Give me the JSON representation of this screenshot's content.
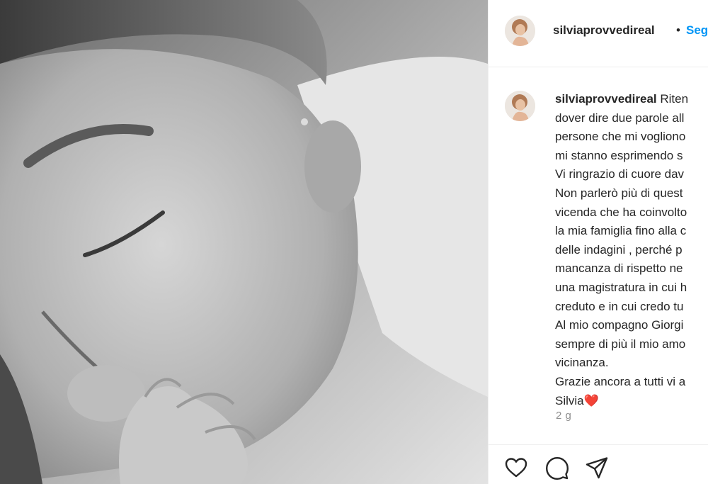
{
  "post": {
    "username": "silviaprovvedireal",
    "follow_label": "Segui",
    "separator": "•",
    "caption_lines": [
      " Riten",
      "dover dire due parole all",
      "persone che mi vogliono",
      "mi stanno esprimendo s",
      "Vi ringrazio di cuore dav",
      "Non parlerò più di quest",
      "vicenda che ha coinvolto",
      "la mia famiglia fino alla c",
      "delle indagini , perché p",
      "mancanza di rispetto ne",
      "una magistratura in cui h",
      "creduto e in cui credo tu",
      "Al mio compagno Giorgi",
      "sempre di più il mio amo",
      "vicinanza.",
      "Grazie ancora a tutti vi a",
      "Silvia"
    ],
    "caption_emoji": "❤️",
    "time_ago": "2 g"
  },
  "actions": {
    "like": "heart-icon",
    "comment": "comment-icon",
    "share": "share-icon"
  },
  "colors": {
    "text": "#262626",
    "secondary": "#8e8e8e",
    "follow": "#0095f6",
    "divider": "#efefef",
    "heart": "#ed1c24"
  }
}
